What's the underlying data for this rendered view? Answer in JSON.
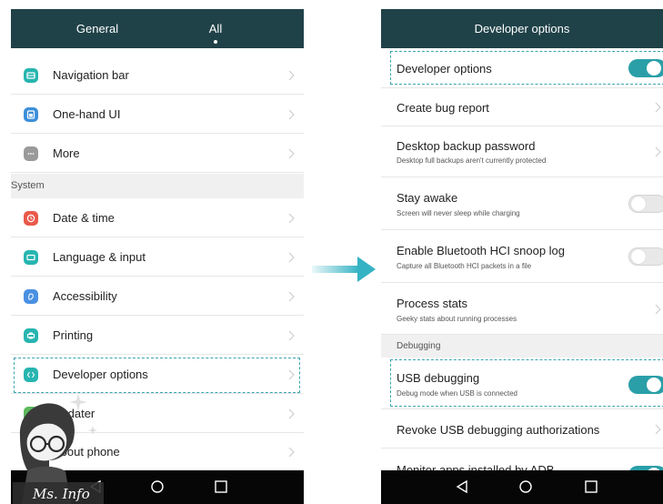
{
  "left": {
    "tabs": [
      {
        "label": "General"
      },
      {
        "label": "All"
      }
    ],
    "rows": [
      {
        "label": "Navigation bar",
        "icon": "navigation-icon",
        "color": "#27b5b0"
      },
      {
        "label": "One-hand UI",
        "icon": "one-hand-icon",
        "color": "#3c8fd9"
      },
      {
        "label": "More",
        "icon": "more-icon",
        "color": "#9a9a9a"
      }
    ],
    "section": "System",
    "system_rows": [
      {
        "label": "Date & time",
        "icon": "clock-icon",
        "color": "#e9594a"
      },
      {
        "label": "Language & input",
        "icon": "keyboard-icon",
        "color": "#27b5b0"
      },
      {
        "label": "Accessibility",
        "icon": "accessibility-icon",
        "color": "#4a90e2"
      },
      {
        "label": "Printing",
        "icon": "printer-icon",
        "color": "#27b5b0"
      },
      {
        "label": "Developer options",
        "icon": "developer-icon",
        "color": "#27b5b0"
      },
      {
        "label": "Updater",
        "icon": "updater-icon",
        "color": "#5cb85c"
      },
      {
        "label": "About phone",
        "icon": "phone-icon",
        "color": "#9a9a9a"
      }
    ]
  },
  "right": {
    "title": "Developer options",
    "rows": [
      {
        "title": "Developer options",
        "sub": "",
        "control": "toggle-on"
      },
      {
        "title": "Create bug report",
        "sub": "",
        "control": "chevron"
      },
      {
        "title": "Desktop backup password",
        "sub": "Desktop full backups aren't currently protected",
        "control": "chevron"
      },
      {
        "title": "Stay awake",
        "sub": "Screen will never sleep while charging",
        "control": "toggle-off"
      },
      {
        "title": "Enable Bluetooth HCI snoop log",
        "sub": "Capture all Bluetooth HCI packets in a file",
        "control": "toggle-off"
      },
      {
        "title": "Process stats",
        "sub": "Geeky stats about running processes",
        "control": "chevron"
      }
    ],
    "section": "Debugging",
    "debug_rows": [
      {
        "title": "USB debugging",
        "sub": "Debug mode when USB is connected",
        "control": "toggle-on"
      },
      {
        "title": "Revoke USB debugging authorizations",
        "sub": "",
        "control": "chevron"
      },
      {
        "title": "Monitor apps installed by ADB",
        "sub": "",
        "control": "toggle-on"
      }
    ]
  },
  "watermark": {
    "text": "Ms. Info"
  },
  "colors": {
    "accent": "#2a9fa8",
    "topbar": "#1f4248",
    "navbar": "#060606",
    "arrow": "#35b3c4"
  }
}
